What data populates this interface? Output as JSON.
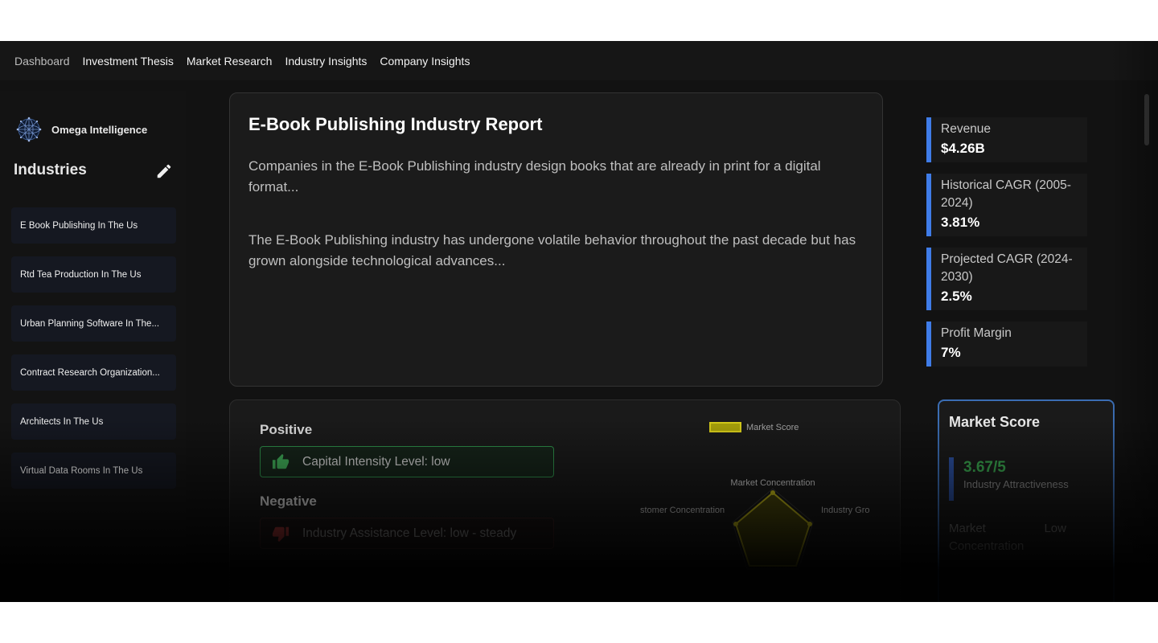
{
  "nav": {
    "items": [
      "Dashboard",
      "Investment Thesis",
      "Market Research",
      "Industry Insights",
      "Company Insights"
    ]
  },
  "sidebar": {
    "brand": "Omega Intelligence",
    "title": "Industries",
    "items": [
      "E Book Publishing In The Us",
      "Rtd Tea Production In The Us",
      "Urban Planning Software In The...",
      "Contract Research Organization...",
      "Architects In The Us",
      "Virtual Data Rooms In The Us"
    ]
  },
  "report": {
    "title": "E-Book Publishing Industry Report",
    "paragraph1": "Companies in the E-Book Publishing industry design books that are already in print for a digital format...",
    "paragraph2": "The E-Book Publishing industry has undergone volatile behavior throughout the past decade but has grown alongside technological advances..."
  },
  "metrics": [
    {
      "label": "Revenue",
      "value": "$4.26B"
    },
    {
      "label": "Historical CAGR (2005-2024)",
      "value": "3.81%"
    },
    {
      "label": "Projected CAGR (2024-2030)",
      "value": "2.5%"
    },
    {
      "label": "Profit Margin",
      "value": "7%"
    }
  ],
  "factors": {
    "positive_title": "Positive",
    "positive_item": "Capital Intensity Level: low",
    "negative_title": "Negative",
    "negative_item": "Industry Assistance Level: low - steady"
  },
  "chart": {
    "legend": "Market Score",
    "labels": {
      "top": "Market Concentration",
      "left": "stomer Concentration",
      "right": "Industry Gro"
    },
    "series_color": "#a8a10a"
  },
  "market_score": {
    "title": "Market Score",
    "value": "3.67/5",
    "subtitle": "Industry Attractiveness",
    "row_label": "Market Concentration",
    "row_value": "Low"
  },
  "colors": {
    "accent": "#3f7ce8",
    "positive": "#38a24d",
    "background": "#121212"
  }
}
